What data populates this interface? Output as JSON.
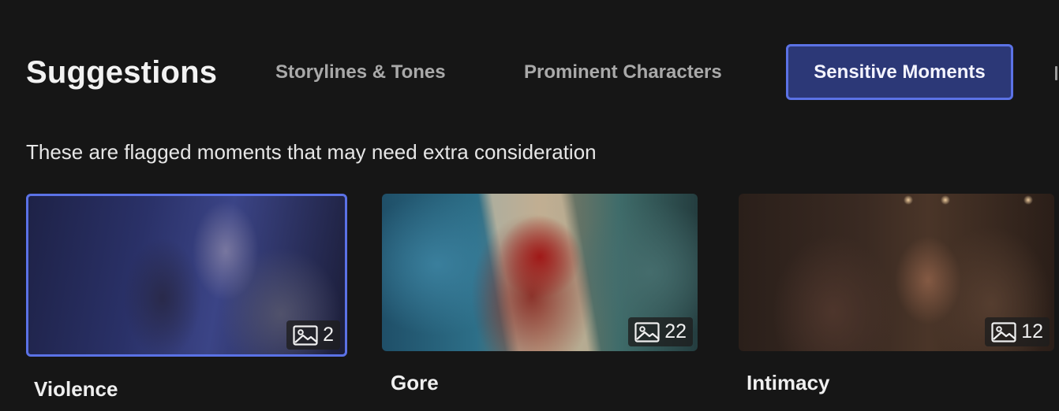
{
  "header": {
    "title": "Suggestions",
    "tabs": [
      {
        "label": "Storylines & Tones",
        "active": false
      },
      {
        "label": "Prominent Characters",
        "active": false
      },
      {
        "label": "Sensitive Moments",
        "active": true
      }
    ]
  },
  "subtitle": "These are flagged moments that may need extra consideration",
  "cards": [
    {
      "label": "Violence",
      "count": "2",
      "icon": "image-icon",
      "selected": true
    },
    {
      "label": "Gore",
      "count": "22",
      "icon": "image-icon",
      "selected": false
    },
    {
      "label": "Intimacy",
      "count": "12",
      "icon": "image-icon",
      "selected": false
    }
  ],
  "colors": {
    "background": "#161616",
    "accent": "#5b72e6",
    "active_tab_fill": "#2c3877",
    "inactive_tab_text": "#a9a9a9"
  }
}
